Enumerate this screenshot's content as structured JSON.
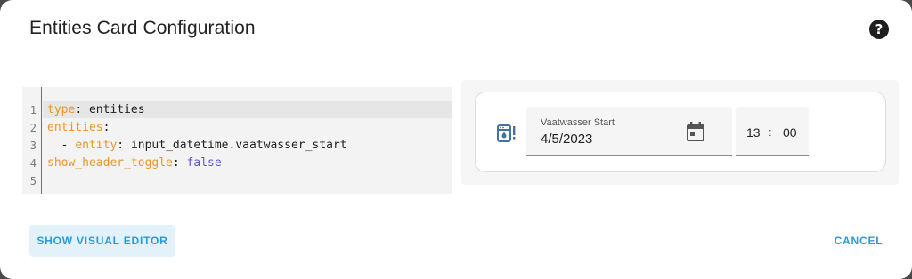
{
  "dialog": {
    "title": "Entities Card Configuration",
    "help_icon": "help-circle-icon"
  },
  "editor": {
    "line_numbers": [
      "1",
      "2",
      "3",
      "4",
      "5"
    ],
    "lines": [
      {
        "key": "type",
        "sep": ": ",
        "value": "entities"
      },
      {
        "key": "entities",
        "sep": ":",
        "value": ""
      },
      {
        "prefix": "  - ",
        "key": "entity",
        "sep": ": ",
        "value": "input_datetime.vaatwasser_start"
      },
      {
        "key": "show_header_toggle",
        "sep": ": ",
        "value": "false"
      },
      {
        "key": "",
        "sep": "",
        "value": ""
      }
    ],
    "colors": {
      "key": "#e8952b",
      "bool": "#5856d6",
      "text": "#202020"
    }
  },
  "preview": {
    "entity_icon": "dishwasher-alert-icon",
    "date_label": "Vaatwasser Start",
    "date_value": "4/5/2023",
    "calendar_icon": "calendar-icon",
    "time_hours": "13",
    "time_separator": ":",
    "time_minutes": "00"
  },
  "actions": {
    "show_visual_editor": "SHOW VISUAL EDITOR",
    "cancel": "CANCEL",
    "accent_color": "#2b9ad8"
  }
}
